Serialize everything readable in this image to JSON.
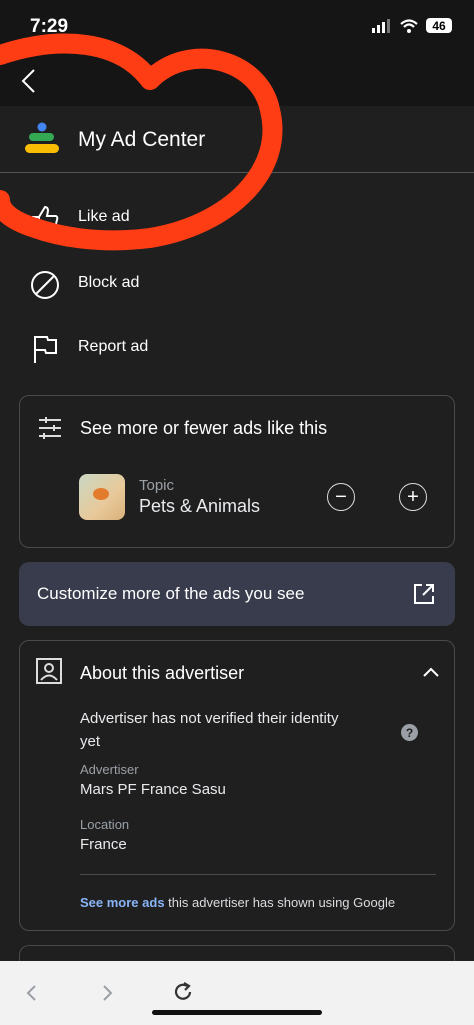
{
  "status": {
    "time": "7:29",
    "battery": "46"
  },
  "header": {
    "title": "My Ad Center"
  },
  "menu": [
    {
      "label": "Like ad"
    },
    {
      "label": "Block ad"
    },
    {
      "label": "Report ad"
    }
  ],
  "see_more": {
    "title": "See more or fewer ads like this",
    "topic_label": "Topic",
    "topic_value": "Pets & Animals"
  },
  "customize": {
    "label": "Customize more of the ads you see"
  },
  "advertiser": {
    "title": "About this advertiser",
    "identity_line1": "Advertiser has not verified their identity",
    "identity_line2": "yet",
    "advertiser_label": "Advertiser",
    "advertiser_value": "Mars PF France Sasu",
    "location_label": "Location",
    "location_value": "France",
    "link_text": "See more ads",
    "link_suffix": " this advertiser has shown using Google"
  },
  "colors": {
    "annotation": "#ff3d14",
    "link": "#8ab4f8",
    "card_bg": "#393c4c"
  }
}
